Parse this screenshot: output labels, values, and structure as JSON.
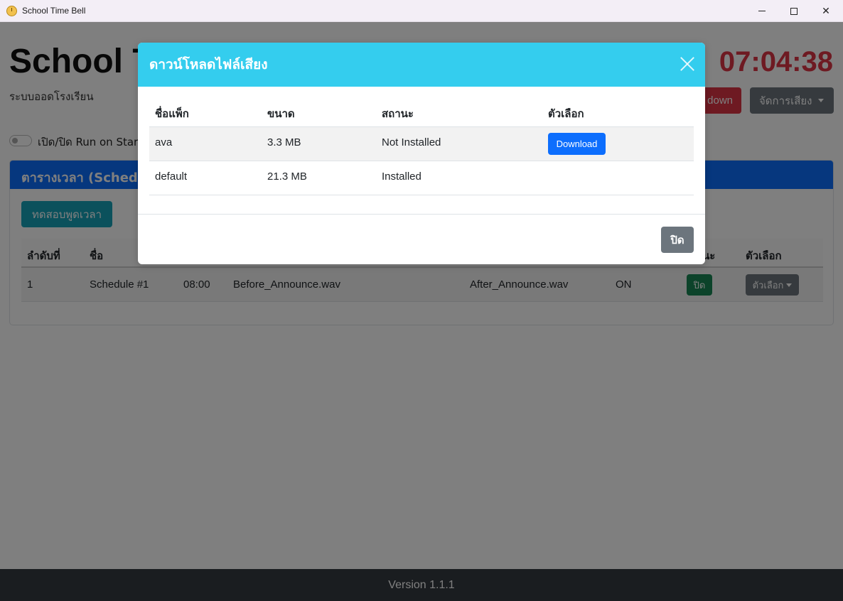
{
  "window": {
    "title": "School Time Bell",
    "minimize_icon": "minimize-icon",
    "maximize_icon": "maximize-icon",
    "close_icon": "close-icon"
  },
  "header": {
    "title_visible": "School T",
    "subtitle": "ระบบออดโรงเรียน",
    "clock": "07:04:38",
    "shutdown_label_visible": "down",
    "sound_menu_label": "จัดการเสียง",
    "toggle_label_visible": "เปิด/ปิด Run on Start"
  },
  "schedule_card": {
    "header_visible": "ตารางเวลา (Schedu",
    "test_button": "ทดสอบพูดเวลา",
    "columns": {
      "order": "ลำดับที่",
      "name": "ชื่อ",
      "status_visible": "นะ",
      "options": "ตัวเลือก"
    },
    "rows": [
      {
        "order": "1",
        "name": "Schedule #1",
        "time": "08:00",
        "before_sound": "Before_Announce.wav",
        "after_sound": "After_Announce.wav",
        "state": "ON",
        "toggle_label": "ปิด",
        "options_label": "ตัวเลือก"
      }
    ]
  },
  "modal": {
    "title": "ดาวน์โหลดไฟล์เสียง",
    "columns": {
      "pack_name": "ชื่อแพ็ก",
      "size": "ขนาด",
      "status": "สถานะ",
      "options": "ตัวเลือก"
    },
    "rows": [
      {
        "pack_name": "ava",
        "size": "3.3 MB",
        "status": "Not Installed",
        "action": "Download"
      },
      {
        "pack_name": "default",
        "size": "21.3 MB",
        "status": "Installed",
        "action": ""
      }
    ],
    "close_button": "ปิด"
  },
  "footer": {
    "version": "Version 1.1.1"
  },
  "colors": {
    "modal_header": "#34cdee",
    "primary": "#0d6efd",
    "danger": "#dc3545",
    "secondary": "#6c757d",
    "success": "#198754",
    "info": "#17a2b8",
    "footer": "#343a40"
  }
}
